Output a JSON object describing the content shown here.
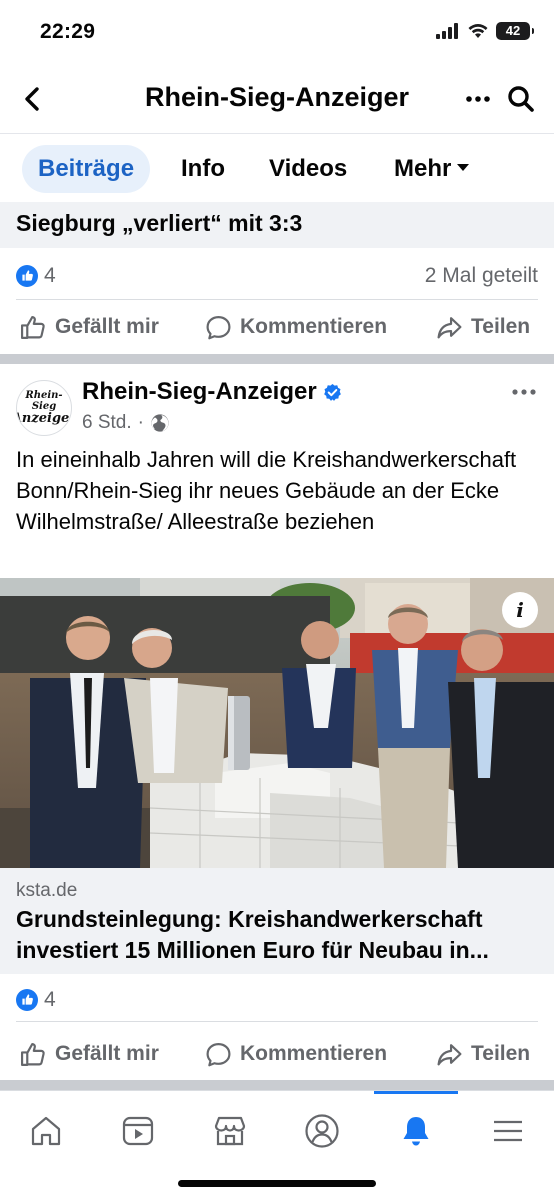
{
  "status_bar": {
    "time": "22:29",
    "battery": "42"
  },
  "header": {
    "title": "Rhein-Sieg-Anzeiger"
  },
  "tabs": [
    {
      "label": "Beiträge",
      "active": true
    },
    {
      "label": "Info"
    },
    {
      "label": "Videos"
    },
    {
      "label": "Mehr"
    }
  ],
  "previous_post": {
    "headline_tail": "Siegburg „verliert“ mit 3:3",
    "reaction_count": "4",
    "shares": "2 Mal geteilt"
  },
  "actions": {
    "like": "Gefällt mir",
    "comment": "Kommentieren",
    "share": "Teilen"
  },
  "post": {
    "avatar_text_1": "Rhein-Sieg",
    "avatar_text_2": "Anzeiger",
    "page_name": "Rhein-Sieg-Anzeiger",
    "time": "6 Std.",
    "text": "In eineinhalb Jahren will die Kreishandwerkerschaft Bonn/Rhein-Sieg ihr neues Gebäude an der Ecke Wilhelmstraße/ Alleestraße beziehen",
    "image_info": "i",
    "link_domain": "ksta.de",
    "link_headline": "Grundsteinlegung: Kreishandwerkerschaft investiert 15 Millionen Euro für Neubau in...",
    "reaction_count": "4"
  },
  "colors": {
    "accent": "#1877f2",
    "tab_active_bg": "#e7f0fb",
    "tab_active_text": "#1c63c4",
    "secondary_text": "#65676b"
  },
  "bottom_nav": [
    "home-icon",
    "video-icon",
    "marketplace-icon",
    "profile-icon",
    "bell-icon",
    "menu-icon"
  ]
}
